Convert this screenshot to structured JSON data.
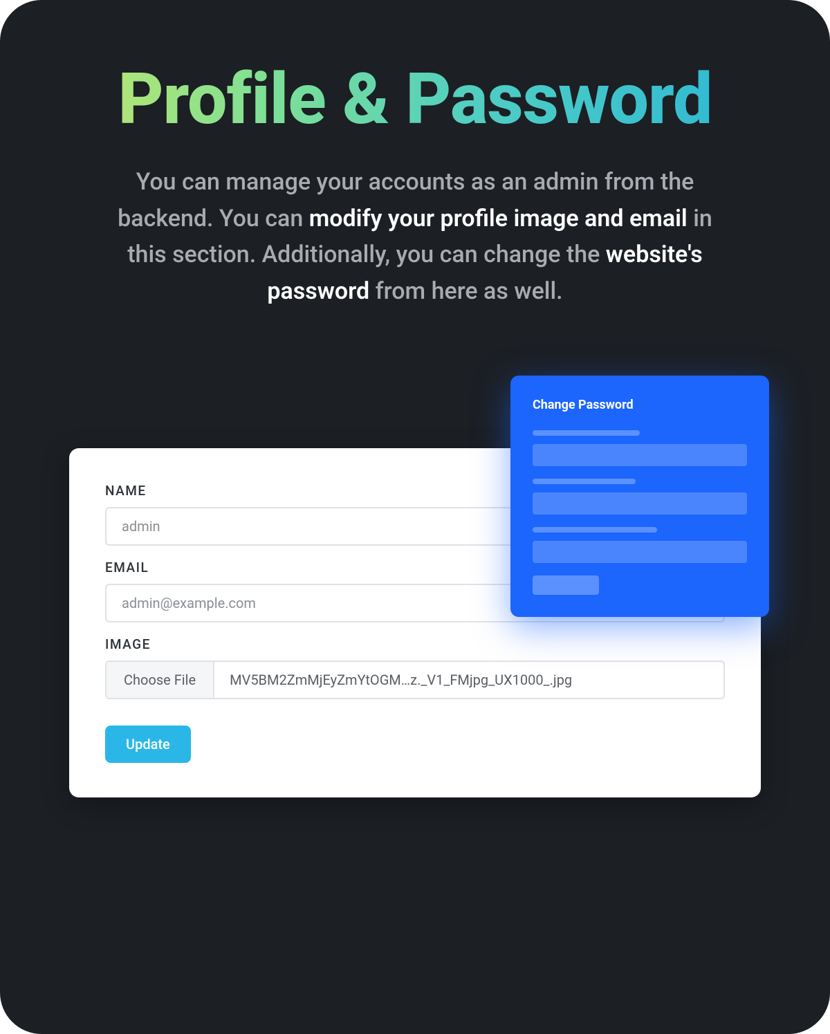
{
  "header": {
    "title": "Profile & Password"
  },
  "description": {
    "part1": "You can manage your accounts as an admin from the backend. You can ",
    "highlight1": "modify your profile image and email",
    "part2": " in this section. Additionally, you can change the ",
    "highlight2": "website's password",
    "part3": " from here as well."
  },
  "profile_form": {
    "name": {
      "label": "NAME",
      "value": "admin"
    },
    "email": {
      "label": "EMAIL",
      "value": "admin@example.com"
    },
    "image": {
      "label": "IMAGE",
      "button_label": "Choose File",
      "filename": "MV5BM2ZmMjEyZmYtOGM…z._V1_FMjpg_UX1000_.jpg"
    },
    "submit_label": "Update"
  },
  "password_card": {
    "title": "Change Password"
  }
}
